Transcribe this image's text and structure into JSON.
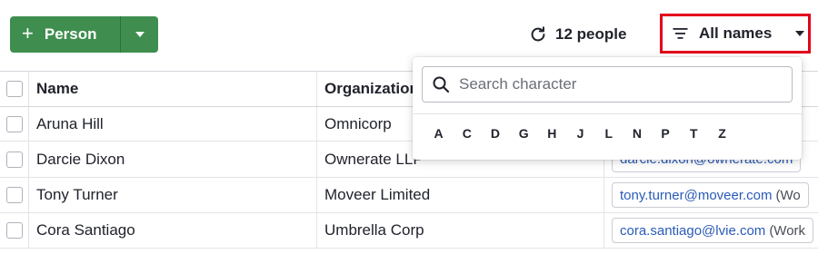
{
  "toolbar": {
    "add_button_icon": "plus-icon",
    "add_button_label": "Person",
    "count_label": "12 people",
    "refresh_icon": "refresh-icon",
    "filter_icon": "filter-icon",
    "filter_label": "All names"
  },
  "table": {
    "columns": [
      "Name",
      "Organization"
    ],
    "rows": [
      {
        "name": "Aruna Hill",
        "org": "Omnicorp",
        "email": "",
        "email_tag": ""
      },
      {
        "name": "Darcie Dixon",
        "org": "Ownerate LLP",
        "email": "darcie.dixon@ownerate.com",
        "email_tag": ""
      },
      {
        "name": "Tony Turner",
        "org": "Moveer Limited",
        "email": "tony.turner@moveer.com",
        "email_tag": "(Wo"
      },
      {
        "name": "Cora Santiago",
        "org": "Umbrella Corp",
        "email": "cora.santiago@lvie.com",
        "email_tag": "(Work"
      }
    ]
  },
  "dropdown": {
    "search_placeholder": "Search character",
    "letters": [
      "A",
      "C",
      "D",
      "G",
      "H",
      "J",
      "L",
      "N",
      "P",
      "T",
      "Z"
    ]
  },
  "colors": {
    "primary_green": "#3f8e4f",
    "highlight_red": "#e3001b",
    "link_blue": "#2a5bb8"
  }
}
